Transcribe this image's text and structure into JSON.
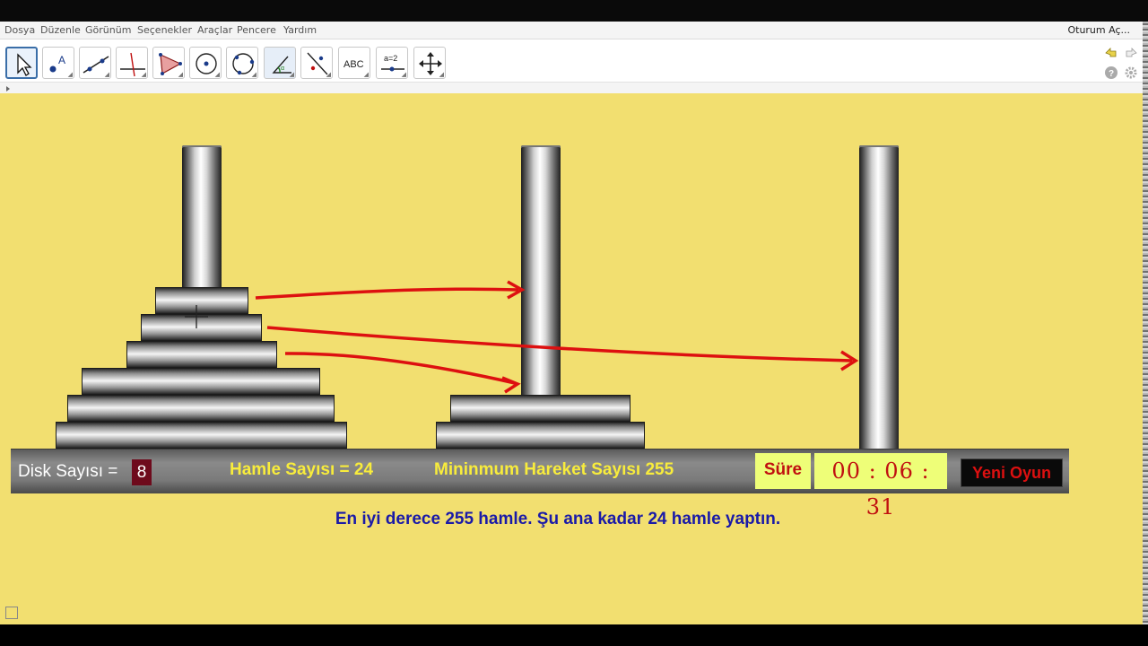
{
  "menu": {
    "items": [
      "Dosya",
      "Düzenle",
      "Görünüm",
      "Seçenekler",
      "Araçlar",
      "Pencere",
      "Yardım"
    ],
    "login": "Oturum Aç..."
  },
  "toolbar": {
    "tools": [
      "move-tool",
      "point-tool",
      "line-tool",
      "perpendicular-tool",
      "polygon-tool",
      "circle-center-tool",
      "circle-three-points-tool",
      "angle-tool",
      "reflect-tool",
      "text-tool",
      "slider-tool",
      "move-view-tool"
    ],
    "text_tool_label": "ABC",
    "slider_tool_label": "a=2"
  },
  "game": {
    "disk_label": "Disk Sayısı =",
    "disk_count": "8",
    "move_count_label": "Hamle Sayısı = 24",
    "min_moves_label": "Mininmum Hareket Sayısı 255",
    "time_label": "Süre",
    "timer": "00 : 06 : 31",
    "new_game_button": "Yeni Oyun",
    "message": "En iyi derece 255 hamle. Şu ana kadar 24 hamle yaptın."
  },
  "colors": {
    "canvas_bg": "#f2df70",
    "annotation_arrows": "#dd1010",
    "message_text": "#1a1aa8",
    "stat_text": "#f8ec3c",
    "timer_bg": "#eefe78"
  }
}
